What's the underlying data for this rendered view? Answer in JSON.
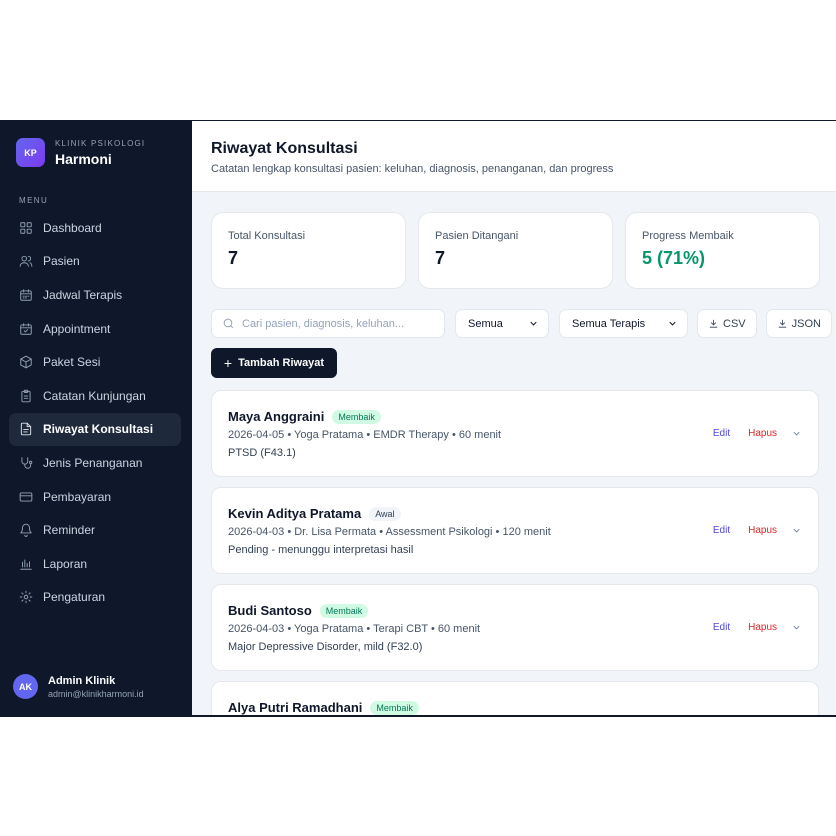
{
  "brand": {
    "logo": "KP",
    "subtitle": "KLINIK PSIKOLOGI",
    "name": "Harmoni"
  },
  "sidebar": {
    "menu_label": "MENU",
    "items": [
      {
        "label": "Dashboard",
        "icon": "grid-icon",
        "active": false
      },
      {
        "label": "Pasien",
        "icon": "users-icon",
        "active": false
      },
      {
        "label": "Jadwal Terapis",
        "icon": "calendar-icon",
        "active": false
      },
      {
        "label": "Appointment",
        "icon": "calendar-check-icon",
        "active": false
      },
      {
        "label": "Paket Sesi",
        "icon": "package-icon",
        "active": false
      },
      {
        "label": "Catatan Kunjungan",
        "icon": "clipboard-icon",
        "active": false
      },
      {
        "label": "Riwayat Konsultasi",
        "icon": "file-text-icon",
        "active": true
      },
      {
        "label": "Jenis Penanganan",
        "icon": "stethoscope-icon",
        "active": false
      },
      {
        "label": "Pembayaran",
        "icon": "credit-card-icon",
        "active": false
      },
      {
        "label": "Reminder",
        "icon": "bell-icon",
        "active": false
      },
      {
        "label": "Laporan",
        "icon": "bar-chart-icon",
        "active": false
      },
      {
        "label": "Pengaturan",
        "icon": "gear-icon",
        "active": false
      }
    ]
  },
  "user": {
    "initials": "AK",
    "name": "Admin Klinik",
    "email": "admin@klinikharmoni.id"
  },
  "header": {
    "title": "Riwayat Konsultasi",
    "subtitle": "Catatan lengkap konsultasi pasien: keluhan, diagnosis, penanganan, dan progress"
  },
  "stats": [
    {
      "label": "Total Konsultasi",
      "value": "7"
    },
    {
      "label": "Pasien Ditangani",
      "value": "7"
    },
    {
      "label": "Progress Membaik",
      "value": "5 (71%)"
    }
  ],
  "toolbar": {
    "search_placeholder": "Cari pasien, diagnosis, keluhan...",
    "search_value": "",
    "status_filter": "Semua",
    "therapist_filter": "Semua Terapis",
    "csv_label": "CSV",
    "json_label": "JSON"
  },
  "add_button": "Tambah Riwayat",
  "records": [
    {
      "name": "Maya Anggraini",
      "status": "Membaik",
      "meta": "2026-04-05 • Yoga Pratama • EMDR Therapy • 60 menit",
      "diagnosis": "PTSD (F43.1)"
    },
    {
      "name": "Kevin Aditya Pratama",
      "status": "Awal",
      "meta": "2026-04-03 • Dr. Lisa Permata • Assessment Psikologi • 120 menit",
      "diagnosis": "Pending - menunggu interpretasi hasil"
    },
    {
      "name": "Budi Santoso",
      "status": "Membaik",
      "meta": "2026-04-03 • Yoga Pratama • Terapi CBT • 60 menit",
      "diagnosis": "Major Depressive Disorder, mild (F32.0)"
    },
    {
      "name": "Alya Putri Ramadhani",
      "status": "Membaik",
      "meta": "",
      "diagnosis": ""
    }
  ],
  "actions": {
    "edit": "Edit",
    "delete": "Hapus"
  },
  "colors": {
    "sidebar_bg": "#0f172a",
    "accent": "#6366f1",
    "success": "#059669",
    "danger": "#dc2626"
  }
}
